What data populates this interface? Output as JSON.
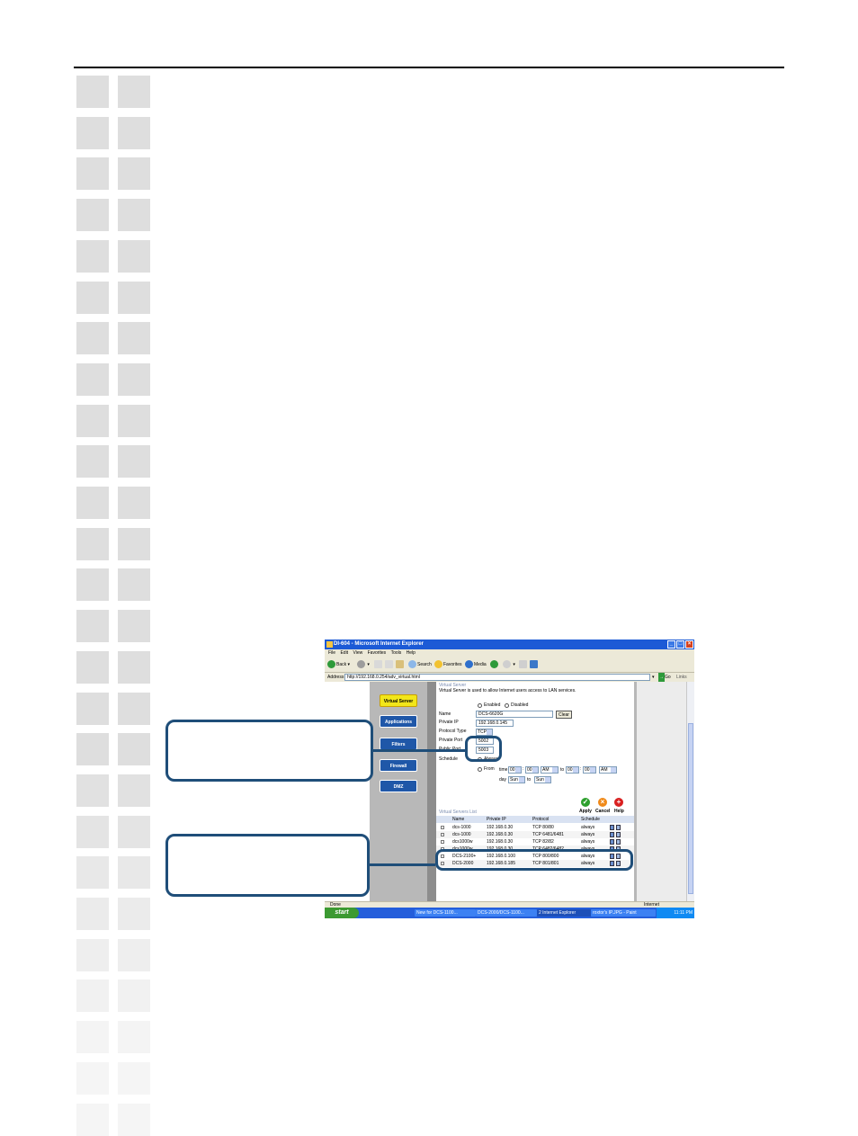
{
  "window": {
    "title": "DI-604 - Microsoft Internet Explorer",
    "menu": [
      "File",
      "Edit",
      "View",
      "Favorites",
      "Tools",
      "Help"
    ],
    "toolbar": {
      "back": "Back",
      "search": "Search",
      "favorites": "Favorites",
      "media": "Media"
    },
    "address_label": "Address",
    "address_value": "http://192.168.0.254/adv_virtual.html",
    "go": "Go",
    "links": "Links"
  },
  "nav": {
    "items": [
      {
        "label": "Virtual Server",
        "active": true
      },
      {
        "label": "Applications",
        "active": false
      },
      {
        "label": "Filters",
        "active": false
      },
      {
        "label": "Firewall",
        "active": false
      },
      {
        "label": "DMZ",
        "active": false
      }
    ]
  },
  "form": {
    "heading": "Virtual Server",
    "description": "Virtual Server is used to allow Internet users access to LAN services.",
    "enabled_label": "Enabled",
    "disabled_label": "Disabled",
    "name_label": "Name",
    "name_value": "DCS-6620G",
    "clear_button": "Clear",
    "private_ip_label": "Private IP",
    "private_ip_value": "192.168.0.145",
    "protocol_type_label": "Protocol Type",
    "protocol_value": "TCP",
    "private_port_label": "Private Port",
    "private_port_value": "5002",
    "public_port_label": "Public Port",
    "public_port_value": "5003",
    "schedule_label": "Schedule",
    "always_label": "Always",
    "from_label": "From",
    "time_label": "time",
    "hour_from": "00",
    "min_from": "00",
    "ampm_from": "AM",
    "to_label": "to",
    "hour_to": "00",
    "min_to": "00",
    "ampm_to": "AM",
    "day_label": "day",
    "day_from": "Sun",
    "day_to": "Sun"
  },
  "actions": {
    "apply": "Apply",
    "cancel": "Cancel",
    "help": "Help"
  },
  "list": {
    "heading": "Virtual Servers List",
    "columns": [
      "Name",
      "Private IP",
      "Protocol",
      "Schedule"
    ],
    "rows": [
      {
        "name": "dcs-1000",
        "ip": "192.168.0.30",
        "protocol": "TCP 80/80",
        "schedule": "always"
      },
      {
        "name": "dcs-1000",
        "ip": "192.168.0.30",
        "protocol": "TCP 6481/6481",
        "schedule": "always"
      },
      {
        "name": "dcs1000w",
        "ip": "192.168.0.30",
        "protocol": "TCP 82/82",
        "schedule": "always"
      },
      {
        "name": "dcs1000w",
        "ip": "192.168.0.30",
        "protocol": "TCP 6482/6482",
        "schedule": "always"
      },
      {
        "name": "DCS-2100+",
        "ip": "192.168.0.100",
        "protocol": "TCP 800/800",
        "schedule": "always"
      },
      {
        "name": "DCS-2000",
        "ip": "192.168.0.185",
        "protocol": "TCP 801/801",
        "schedule": "always"
      }
    ]
  },
  "statusbar": {
    "left": "Done",
    "right": "Internet"
  },
  "taskbar": {
    "start": "start",
    "tasks": [
      "New for DCS-1100...",
      "DCS-2000/DCS-1100...",
      "2 Internet Explorer",
      "roxtor's IP.JPG - Paint"
    ],
    "clock": "11:11 PM"
  },
  "colors": {
    "callout_border": "#1f4e79",
    "nav_button": "#1f57a8",
    "nav_active": "#f2e61a",
    "titlebar": "#1c5ad6"
  }
}
